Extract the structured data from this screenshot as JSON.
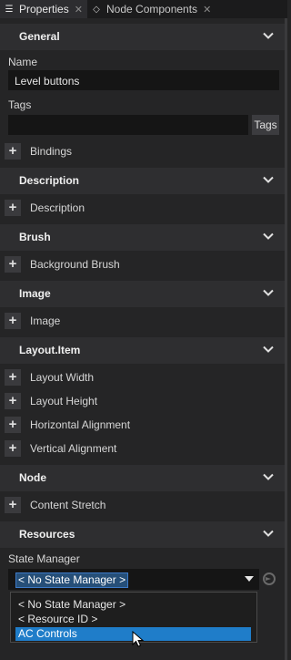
{
  "tabs": [
    {
      "label": "Properties",
      "icon": "list-icon",
      "active": true
    },
    {
      "label": "Node Components",
      "icon": "components-icon",
      "active": false
    }
  ],
  "sections": {
    "general": "General",
    "description": "Description",
    "brush": "Brush",
    "image": "Image",
    "layout_item": "Layout.Item",
    "node": "Node",
    "resources": "Resources"
  },
  "general": {
    "name_label": "Name",
    "name_value": "Level buttons",
    "tags_label": "Tags",
    "tags_button": "Tags",
    "bindings": "Bindings"
  },
  "description": {
    "item": "Description"
  },
  "brush": {
    "item": "Background Brush"
  },
  "image": {
    "item": "Image"
  },
  "layout_item": {
    "items": [
      "Layout Width",
      "Layout Height",
      "Horizontal Alignment",
      "Vertical Alignment"
    ]
  },
  "node": {
    "item": "Content Stretch"
  },
  "resources": {
    "state_manager_label": "State Manager",
    "selected": "< No State Manager >",
    "options": [
      "< No State Manager >",
      "< Resource ID >",
      "AC Controls"
    ],
    "highlighted_option": "AC Controls"
  },
  "colors": {
    "background": "#252526",
    "section_header": "#2e2e30",
    "highlight": "#1f7dc9"
  }
}
